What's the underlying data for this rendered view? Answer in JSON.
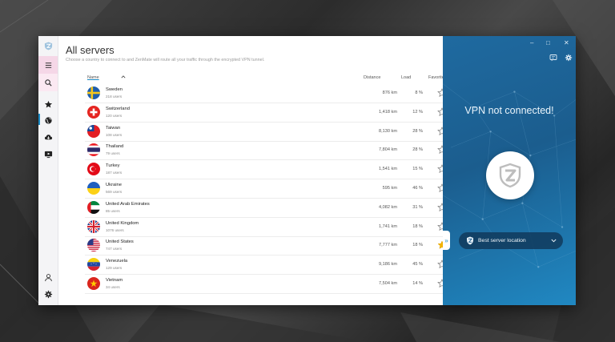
{
  "main": {
    "title": "All servers",
    "subtitle": "Choose a country to connect to and ZenMate will route all your traffic through the encrypted VPN tunnel.",
    "columns": {
      "name": "Name",
      "distance": "Distance",
      "load": "Load",
      "favorite": "Favorite"
    },
    "rows": [
      {
        "name": "Sweden",
        "users": "218 users",
        "distance": "876 km",
        "load": "8 %",
        "favorite": false,
        "flag": "sweden-flag-icon"
      },
      {
        "name": "Switzerland",
        "users": "120 users",
        "distance": "1,418 km",
        "load": "12 %",
        "favorite": false,
        "flag": "switzerland-flag-icon"
      },
      {
        "name": "Taiwan",
        "users": "108 users",
        "distance": "8,130 km",
        "load": "28 %",
        "favorite": false,
        "flag": "taiwan-flag-icon"
      },
      {
        "name": "Thailand",
        "users": "79 users",
        "distance": "7,804 km",
        "load": "28 %",
        "favorite": false,
        "flag": "thailand-flag-icon"
      },
      {
        "name": "Turkey",
        "users": "187 users",
        "distance": "1,541 km",
        "load": "15 %",
        "favorite": false,
        "flag": "turkey-flag-icon"
      },
      {
        "name": "Ukraine",
        "users": "569 users",
        "distance": "595 km",
        "load": "46 %",
        "favorite": false,
        "flag": "ukraine-flag-icon"
      },
      {
        "name": "United Arab Emirates",
        "users": "85 users",
        "distance": "4,082 km",
        "load": "31 %",
        "favorite": false,
        "flag": "uae-flag-icon"
      },
      {
        "name": "United Kingdom",
        "users": "1076 users",
        "distance": "1,741 km",
        "load": "18 %",
        "favorite": false,
        "flag": "uk-flag-icon"
      },
      {
        "name": "United States",
        "users": "747 users",
        "distance": "7,777 km",
        "load": "18 %",
        "favorite": true,
        "flag": "us-flag-icon"
      },
      {
        "name": "Venezuela",
        "users": "129 users",
        "distance": "9,186 km",
        "load": "45 %",
        "favorite": false,
        "flag": "venezuela-flag-icon"
      },
      {
        "name": "Vietnam",
        "users": "34 users",
        "distance": "7,504 km",
        "load": "14 %",
        "favorite": false,
        "flag": "vietnam-flag-icon"
      }
    ]
  },
  "vpn": {
    "status": "VPN not connected!",
    "location_label": "Best server location"
  },
  "colors": {
    "accent": "#1b8ac4",
    "vpn_panel": "#1f6aa0",
    "favorite_star": "#f4b400",
    "menu_highlight": "#f5d7e7"
  }
}
